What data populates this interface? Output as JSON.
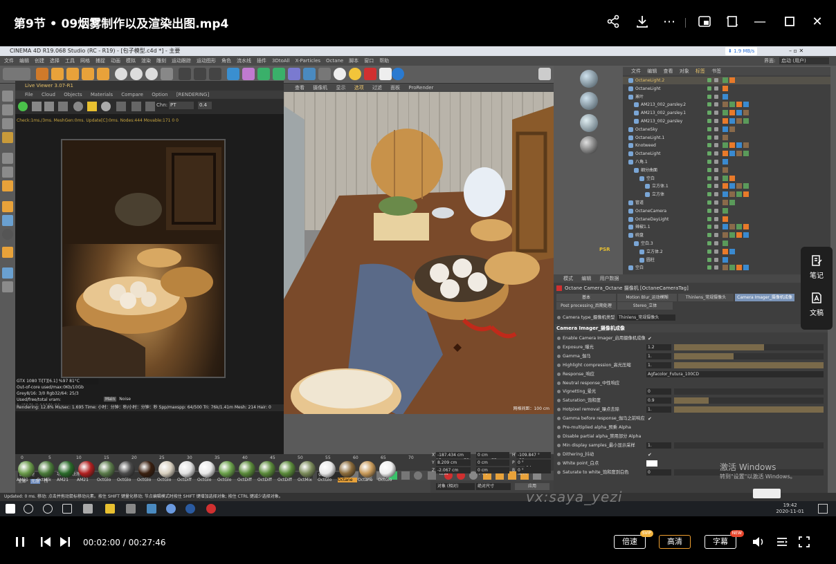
{
  "player": {
    "title": "第9节 • 09烟雾制作以及渲染出图.mp4",
    "current_time": "00:02:00",
    "duration": "00:27:46",
    "speed_label": "倍速",
    "speed_badge": "SVIP",
    "quality_label": "高清",
    "subtitle_label": "字幕",
    "subtitle_badge": "NEW",
    "side_notes_label": "笔记",
    "side_doc_label": "文稿"
  },
  "c4d": {
    "window_title": "CINEMA 4D R19.068 Studio (RC - R19) - [包子模型.c4d *] - 主要",
    "net_speed": "1.9 MB/s",
    "interface_label": "界面:",
    "interface_value": "启动 (用户)",
    "menu": [
      "文件",
      "编辑",
      "创建",
      "选择",
      "工具",
      "网格",
      "捕捉",
      "动画",
      "模拟",
      "渲染",
      "雕刻",
      "运动跟踪",
      "运动图形",
      "角色",
      "流水线",
      "插件",
      "3DtoAll",
      "X-Particles",
      "Octane",
      "脚本",
      "窗口",
      "帮助"
    ],
    "live_viewer": {
      "title": "Live Viewer 3.07-R1",
      "menu": [
        "File",
        "Cloud",
        "Objects",
        "Materials",
        "Compare",
        "Option",
        "[RENDERING]"
      ],
      "chn_label": "Chn:",
      "chn_value": "PT",
      "chn_num": "0.4",
      "stats": "Check:1ms./3ms. MeshGen:0ms. Update[C]:0ms. Nodes:444 Movable:171  0 0",
      "gpu": "GTX 1080 Ti[T][6.1]     %97     81°C",
      "info": [
        "Out-of-core used/max:0Kb/10Gb",
        "Grey8/16: 3/0        Rgb32/64: 25/3",
        "Used/free/total vram: 1.432Gb/8.106Gb/11"
      ],
      "tabs": [
        "Main",
        "Noise"
      ],
      "bottom": "Rendering: 12.8%  Ms/sec: 1.695  Time: 小时：分钟：秒/小时：分钟：秒  Spp/maxspp: 64/500  Tri: 76k/1.41m  Mesh: 214  Hair: 0"
    },
    "viewport": {
      "menu": [
        "查看",
        "摄像机",
        "显示",
        "选项",
        "过滤",
        "面板",
        "ProRender"
      ],
      "grid_label": "网格间距：100 cm"
    },
    "object_manager": {
      "menu": [
        "文件",
        "编辑",
        "查看",
        "对象",
        "标签",
        "书签"
      ],
      "rows": [
        {
          "name": "OctaneLight.2",
          "indent": 0,
          "hl": true
        },
        {
          "name": "OctaneLight",
          "indent": 0,
          "hl": false
        },
        {
          "name": "蒸叶",
          "indent": 0,
          "hl": false
        },
        {
          "name": "AM213_002_parsley.2",
          "indent": 1,
          "hl": false
        },
        {
          "name": "AM213_002_parsley.1",
          "indent": 1,
          "hl": false
        },
        {
          "name": "AM213_002_parsley",
          "indent": 1,
          "hl": false
        },
        {
          "name": "OctaneSky",
          "indent": 0,
          "hl": false
        },
        {
          "name": "OctaneLight.1",
          "indent": 0,
          "hl": false
        },
        {
          "name": "Knotweed",
          "indent": 0,
          "hl": false
        },
        {
          "name": "OctaneLight",
          "indent": 0,
          "hl": false
        },
        {
          "name": "八角.1",
          "indent": 0,
          "hl": false
        },
        {
          "name": "细分曲面",
          "indent": 1,
          "hl": false
        },
        {
          "name": "空白",
          "indent": 2,
          "hl": false
        },
        {
          "name": "立方体.1",
          "indent": 3,
          "hl": false
        },
        {
          "name": "立方体",
          "indent": 3,
          "hl": false
        },
        {
          "name": "管道",
          "indent": 0,
          "hl": false
        },
        {
          "name": "OctaneCamera",
          "indent": 0,
          "hl": false
        },
        {
          "name": "OctaneDayLight",
          "indent": 0,
          "hl": false
        },
        {
          "name": "辣椒1.1",
          "indent": 0,
          "hl": false
        },
        {
          "name": "碗盘",
          "indent": 0,
          "hl": false
        },
        {
          "name": "空白.3",
          "indent": 1,
          "hl": false
        },
        {
          "name": "立方体.2",
          "indent": 2,
          "hl": false
        },
        {
          "name": "圆柱",
          "indent": 2,
          "hl": false
        },
        {
          "name": "空白",
          "indent": 0,
          "hl": false
        }
      ]
    },
    "attribute_manager": {
      "menu": [
        "模式",
        "编辑",
        "用户数据"
      ],
      "header": "Octane Camera_Octane 摄像机 [OctaneCameraTag]",
      "tabs_row1": [
        "基本",
        "Motion Blur_运动模糊",
        "Thinlens_常规摄像头",
        "Camera Imager_摄像机成像"
      ],
      "tabs_row2": [
        "Post processing_后期处理",
        "Stereo_立体"
      ],
      "camera_type_label": "Camera type_摄像机类型",
      "camera_type_value": "Thinlens_常规摄像头",
      "section": "Camera Imager_摄像机成像",
      "params": [
        {
          "label": "Enable Camera Imager_启用摄像机成像",
          "kind": "check",
          "value": "✔"
        },
        {
          "label": "Exposure_曝光",
          "kind": "num",
          "value": "1.2",
          "fill": 0.6
        },
        {
          "label": "Gamma_伽马",
          "kind": "num",
          "value": "1.",
          "fill": 0.4
        },
        {
          "label": "Highlight compression_高光压缩",
          "kind": "num",
          "value": "1.",
          "fill": 1.0
        },
        {
          "label": "Response_响应",
          "kind": "select",
          "value": "Agfacolor_Futura_100CD"
        },
        {
          "label": "Neutral response_中性响应",
          "kind": "check",
          "value": ""
        },
        {
          "label": "Vignetting_晕光",
          "kind": "num",
          "value": "0",
          "fill": 0.0
        },
        {
          "label": "Saturation_饱和度",
          "kind": "num",
          "value": "0.9",
          "fill": 0.23
        },
        {
          "label": "Hotpixel removal_噪点去除",
          "kind": "num",
          "value": "1.",
          "fill": 1.0
        },
        {
          "label": "Gamma before response_伽马之前响应",
          "kind": "check",
          "value": "✔"
        },
        {
          "label": "Pre-multiplied alpha_预乘 Alpha",
          "kind": "check",
          "value": ""
        },
        {
          "label": "Disable partial alpha_禁用部分 Alpha",
          "kind": "check",
          "value": ""
        },
        {
          "label": "Min display samples_最小显示采样",
          "kind": "num",
          "value": "1.",
          "fill": 0.0
        },
        {
          "label": "Dithering_抖动",
          "kind": "check",
          "value": "✔"
        },
        {
          "label": "White point_白点",
          "kind": "color",
          "value": ""
        },
        {
          "label": "Saturate to white_饱和度到白色",
          "kind": "num",
          "value": "0",
          "fill": 0.0
        }
      ]
    },
    "timeline": {
      "ticks": [
        "0",
        "5",
        "10",
        "15",
        "20",
        "25",
        "30",
        "35",
        "40",
        "45",
        "50",
        "55",
        "60",
        "65",
        "70",
        "75",
        "80",
        "85",
        "90"
      ],
      "start": "0 F",
      "end": "90 F",
      "current": "0 F",
      "end_field": "90 F"
    },
    "materials": {
      "menu": [
        "创建",
        "编辑",
        "功能",
        "纹理"
      ],
      "filters": [
        "全部",
        "无层",
        "所"
      ],
      "items": [
        "AM21",
        "OctMix",
        "AM21",
        "AM21",
        "OctGlo",
        "OctGlo",
        "OctGlo",
        "OctGlo",
        "OctDiff",
        "OctGlo",
        "OctGlo",
        "OctDiff",
        "OctDiff",
        "OctDiff",
        "OctMix",
        "OctGlo",
        "Octane",
        "Octane",
        "OctGlo"
      ]
    },
    "coordinates": {
      "headers": [
        "位置",
        "尺寸",
        "旋转"
      ],
      "rows": [
        {
          "axis": "X",
          "pos": "-187.434 cm",
          "size": "0 cm",
          "rot_axis": "H",
          "rot": "-109.847 °"
        },
        {
          "axis": "Y",
          "pos": "8.209 cm",
          "size": "0 cm",
          "rot_axis": "P",
          "rot": "0 °"
        },
        {
          "axis": "Z",
          "pos": "-2.067 cm",
          "size": "0 cm",
          "rot_axis": "B",
          "rot": "0 °"
        }
      ],
      "mode1": "对象 (相对)",
      "mode2": "绝对尺寸",
      "apply": "应用"
    },
    "status": "Updated: 0 ms.    移动: 点击并拖动鼠标移动元素。按住 SHIFT 键量化移动; 节点编辑模式时按住 SHIFT 键增加选择对象; 按住 CTRL 键减少选择对象。",
    "taskbar": {
      "time": "19:42",
      "date": "2020-11-01"
    }
  },
  "overlay": {
    "watermark": "vx:saya_yezi",
    "activate_line1": "激活 Windows",
    "activate_line2": "转到\"设置\"以激活 Windows。"
  }
}
